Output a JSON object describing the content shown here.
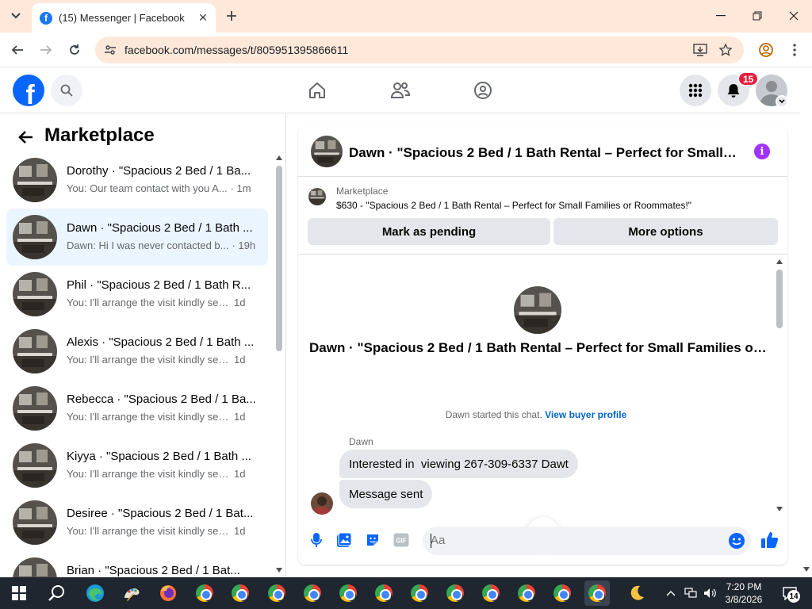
{
  "browser": {
    "tab_title": "(15) Messenger | Facebook",
    "url": "facebook.com/messages/t/805951395866611"
  },
  "fb": {
    "notification_count": "15"
  },
  "sidebar": {
    "title": "Marketplace",
    "conversations": [
      {
        "name": "Dorothy · \"Spacious 2 Bed / 1 Ba...",
        "snippet": "You: Our team contact with you A...",
        "time": "· 1m",
        "active": false
      },
      {
        "name": "Dawn · \"Spacious 2 Bed / 1 Bath ...",
        "snippet": "Dawn: Hi I was never contacted b...",
        "time": "· 19h",
        "active": true
      },
      {
        "name": "Phil · \"Spacious 2 Bed / 1 Bath R...",
        "snippet": "You: I'll arrange the visit kindly sen...",
        "time": "1d",
        "active": false
      },
      {
        "name": "Alexis · \"Spacious 2 Bed / 1 Bath ...",
        "snippet": "You: I'll arrange the visit kindly sen...",
        "time": "1d",
        "active": false
      },
      {
        "name": "Rebecca · \"Spacious 2 Bed / 1 Ba...",
        "snippet": "You: I'll arrange the visit kindly sen...",
        "time": "1d",
        "active": false
      },
      {
        "name": "Kiyya · \"Spacious 2 Bed / 1 Bath ...",
        "snippet": "You: I'll arrange the visit kindly sen...",
        "time": "1d",
        "active": false
      },
      {
        "name": "Desiree · \"Spacious 2 Bed / 1 Bat...",
        "snippet": "You: I'll arrange the visit kindly sen...",
        "time": "1d",
        "active": false
      },
      {
        "name": "Brian · \"Spacious 2 Bed / 1 Bat...",
        "snippet": "",
        "time": "",
        "active": false
      }
    ]
  },
  "chat": {
    "header_title": "Dawn · \"Spacious 2 Bed / 1 Bath Rental – Perfect for Small Fa...",
    "marketplace_label": "Marketplace",
    "listing": "$630 - \"Spacious 2 Bed / 1 Bath Rental – Perfect for Small Families or Roommates!\"",
    "mark_pending_label": "Mark as pending",
    "more_options_label": "More options",
    "profile_title": "Dawn · \"Spacious 2 Bed / 1 Bath Rental – Perfect for Small Families or Ro...",
    "started_text": "Dawn started this chat.",
    "view_profile_link": "View buyer profile",
    "sender_name": "Dawn",
    "messages": [
      "Interested in  viewing 267-309-6337 Dawt",
      "Message sent"
    ],
    "compose_placeholder": "Aa"
  },
  "taskbar": {
    "time": "7:20 PM",
    "date": "3/8/2026",
    "notification_count": "14"
  },
  "colors": {
    "accent": "#0866ff",
    "active_row": "#ebf5ff",
    "chrome_frame": "#fde8da",
    "info": "#a033ff"
  }
}
